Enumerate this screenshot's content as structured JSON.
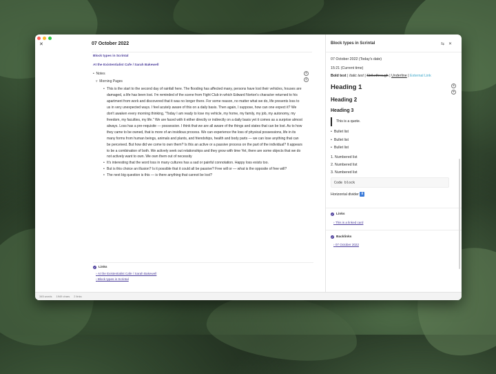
{
  "window": {
    "date_title": "07 October 2022"
  },
  "left": {
    "link1": "Block types in Scrintal",
    "link2": "At the Existentialist Cafe / Sarah Bakewell",
    "notes_label": "Notes",
    "morning_label": "Morning Pages",
    "paragraphs": [
      "This is the start to the second day of rainfall here. The flooding has affected many, persons have lost their vehicles, houses are damaged, a life has been lost. I'm reminded of the scene from Fight Club in which Edward Norton's character returned to his apartment from work and discovered that it was no longer there. For some reason, no matter what we do, life presents loss to us in very unexpected ways. I feel acutely aware of this on a daily basis. Then again, I suppose, how can one expect it? We don't awaken every morning thinking, \"Today I am ready to lose my vehicle, my home, my family, my job, my autonomy, my freedom, my faculties, my life.\" We are faced with it either directly or indirectly on a daily basis yet it comes as a surprise almost always. Loss has a pre-requisite — possession. I think that we are all aware of the things and states that can be lost. As to how they came to be owned, that is more of an insidious process. We can experience the loss of physical possessions, life in its many forms from human beings, animals and plants, and friendships, health and body parts — we can lose anything that can be perceived. But how did we come to own them? Is this an active or a passive process on the part of the individual? It appears to be a combination of both. We actively seek out relationships and they grow with time Yet, there are some objects that we do not actively want to own. We own them out of necessity",
      "It's interesting that the word loss in many cultures has a sad or painful connotation. Happy loss exists too.",
      "But is this choice an illusion? Is it possible that it could all be passive? Free will or — what is the opposite of free will?",
      "The next big question is this — is there anything that cannot be lost?"
    ],
    "links_heading": "Links",
    "links": [
      "At the Existentialist Cafe / Sarah Bakewell",
      "Block types in Scrintal"
    ]
  },
  "status": {
    "words": "345 words",
    "chars": "1949 chars",
    "links": "2 links"
  },
  "right": {
    "title": "Block types in Scrintal",
    "date_line": "07 October 2022 (Today's date)",
    "time_line": "15:21 (Current time)",
    "bold": "Bold text",
    "sep1": " | ",
    "italic": "Italic text",
    "sep2": " | ",
    "strike": "Strikethrough",
    "sep3": " | ",
    "underline": "Underline",
    "sep4": " | ",
    "external": "External Link",
    "h1": "Heading 1",
    "h2": "Heading 2",
    "h3": "Heading 3",
    "quote": "This is a quote.",
    "bullets": [
      "Bullet list",
      "Bullet list",
      "Bullet list"
    ],
    "numbered": [
      "1. Numbered list",
      "2. Numbered list",
      "3. Numbered list"
    ],
    "code": "Code block",
    "hdivider": "Horizontal divider",
    "hdivider_icon": "⬇️",
    "links_heading": "Links",
    "linked_card": "This is a linked card",
    "backlinks_heading": "Backlinks",
    "backlink": "07 October 2022"
  },
  "colors": {
    "accent": "#4a3b9a",
    "external_link": "#3aa6c9"
  }
}
